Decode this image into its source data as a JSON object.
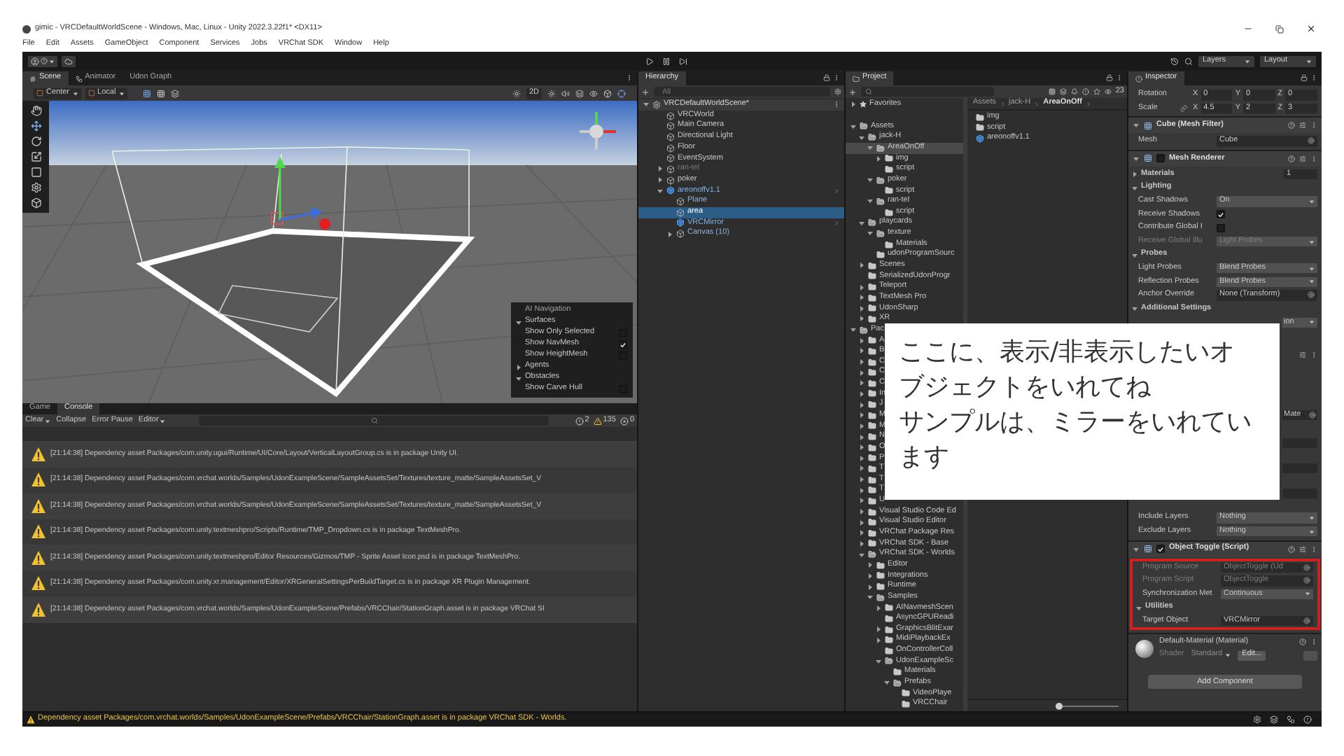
{
  "window": {
    "title": "gimic - VRCDefaultWorldScene - Windows, Mac, Linux - Unity 2022.3.22f1* <DX11>",
    "menu": [
      "File",
      "Edit",
      "Assets",
      "GameObject",
      "Component",
      "Services",
      "Jobs",
      "VRChat SDK",
      "Window",
      "Help"
    ]
  },
  "toolbar": {
    "dropdowns": [
      "Layers",
      "Layout"
    ]
  },
  "scene": {
    "tabs": [
      {
        "label": "Scene",
        "selected": true
      },
      {
        "label": "Animator",
        "selected": false
      },
      {
        "label": "Udon Graph",
        "selected": false
      }
    ],
    "pivot": [
      "Center",
      "Local"
    ],
    "mode_label": "2D",
    "ai_navigation": {
      "title": "AI Navigation",
      "sections": [
        {
          "label": "Surfaces",
          "expanded": true,
          "options": [
            {
              "label": "Show Only Selected",
              "checked": false
            },
            {
              "label": "Show NavMesh",
              "checked": true
            },
            {
              "label": "Show HeightMesh",
              "checked": false
            }
          ]
        },
        {
          "label": "Agents",
          "expanded": false
        },
        {
          "label": "Obstacles",
          "expanded": true,
          "options": [
            {
              "label": "Show Carve Hull",
              "checked": false
            }
          ]
        }
      ]
    }
  },
  "console": {
    "tabs": [
      {
        "label": "Game",
        "selected": false
      },
      {
        "label": "Console",
        "selected": true
      }
    ],
    "buttons": [
      "Clear",
      "Collapse",
      "Error Pause",
      "Editor"
    ],
    "counts": [
      {
        "kind": "info",
        "value": "2"
      },
      {
        "kind": "warning",
        "value": "135"
      },
      {
        "kind": "error",
        "value": "0"
      }
    ],
    "logs": [
      "[21:14:38] Dependency asset Packages/com.unity.ugui/Runtime/UI/Core/Layout/VerticalLayoutGroup.cs is in package Unity UI.",
      "[21:14:38] Dependency asset Packages/com.vrchat.worlds/Samples/UdonExampleScene/SampleAssetsSet/Textures/texture_matte/SampleAssetsSet_V",
      "[21:14:38] Dependency asset Packages/com.vrchat.worlds/Samples/UdonExampleScene/SampleAssetsSet/Textures/texture_matte/SampleAssetsSet_V",
      "[21:14:38] Dependency asset Packages/com.unity.textmeshpro/Scripts/Runtime/TMP_Dropdown.cs is in package TextMeshPro.",
      "[21:14:38] Dependency asset Packages/com.unity.textmeshpro/Editor Resources/Gizmos/TMP - Sprite Asset Icon.psd is in package TextMeshPro.",
      "[21:14:38] Dependency asset Packages/com.unity.xr.management/Editor/XRGeneralSettingsPerBuildTarget.cs is in package XR Plugin Management.",
      "[21:14:38] Dependency asset Packages/com.vrchat.worlds/Samples/UdonExampleScene/Prefabs/VRCChair/StationGraph.asset is in package VRChat SI"
    ],
    "status": "Dependency asset Packages/com.vrchat.worlds/Samples/UdonExampleScene/Prefabs/VRCChair/StationGraph.asset is in package VRChat SDK - Worlds."
  },
  "hierarchy": {
    "title": "Hierarchy",
    "search_placeholder": "All",
    "scene": {
      "label": "VRCDefaultWorldScene*",
      "expanded": true,
      "children": [
        {
          "label": "VRCWorld",
          "kind": "object",
          "selected": false,
          "disabled": false
        },
        {
          "label": "Main Camera",
          "kind": "object",
          "selected": false,
          "disabled": false
        },
        {
          "label": "Directional Light",
          "kind": "object",
          "selected": false,
          "disabled": false
        },
        {
          "label": "Floor",
          "kind": "object",
          "selected": false,
          "disabled": false
        },
        {
          "label": "EventSystem",
          "kind": "object",
          "selected": false,
          "disabled": false
        },
        {
          "label": "ran-tel",
          "kind": "object",
          "selected": false,
          "disabled": true,
          "expanded": false
        },
        {
          "label": "poker",
          "kind": "object",
          "selected": false,
          "disabled": false,
          "expanded": false
        },
        {
          "label": "areonoffv1.1",
          "kind": "prefab",
          "selected": false,
          "disabled": false,
          "expanded": true,
          "children": [
            {
              "label": "Plane",
              "kind": "prefab_part",
              "selected": false,
              "disabled": false
            },
            {
              "label": "area",
              "kind": "prefab_part",
              "selected": true,
              "disabled": false
            },
            {
              "label": "VRCMirror",
              "kind": "prefab",
              "selected": false,
              "disabled": false
            },
            {
              "label": "Canvas (10)",
              "kind": "prefab_part",
              "selected": false,
              "disabled": false,
              "expanded": false
            }
          ]
        }
      ]
    }
  },
  "project": {
    "title": "Project",
    "count": "23",
    "breadcrumb": [
      "Assets",
      "jack-H",
      "AreaOnOff"
    ],
    "tree": [
      {
        "label": "Favorites",
        "kind": "favorites",
        "selected": false,
        "expanded": false
      },
      {
        "label": "Assets",
        "kind": "folder",
        "selected": false,
        "expanded": true,
        "children": [
          {
            "label": "jack-H",
            "selected": false,
            "expanded": true,
            "children": [
              {
                "label": "AreaOnOff",
                "selected": true,
                "expanded": true,
                "children": [
                  {
                    "label": "img",
                    "selected": false,
                    "expanded": false
                  },
                  {
                    "label": "script",
                    "selected": false
                  }
                ]
              },
              {
                "label": "poker",
                "selected": false,
                "expanded": true,
                "children": [
                  {
                    "label": "script",
                    "selected": false
                  }
                ]
              },
              {
                "label": "ran-tel",
                "selected": false,
                "expanded": true,
                "children": [
                  {
                    "label": "script",
                    "selected": false
                  }
                ]
              }
            ]
          },
          {
            "label": "playcards",
            "selected": false,
            "expanded": true,
            "children": [
              {
                "label": "texture",
                "selected": false,
                "expanded": true,
                "children": [
                  {
                    "label": "Materials",
                    "selected": false
                  }
                ]
              },
              {
                "label": "udonProgramSourc",
                "selected": false
              }
            ]
          },
          {
            "label": "Scenes",
            "selected": false,
            "expanded": false
          },
          {
            "label": "SerializedUdonProgr",
            "selected": false
          },
          {
            "label": "Teleport",
            "selected": false,
            "expanded": false
          },
          {
            "label": "TextMesh Pro",
            "selected": false,
            "expanded": false
          },
          {
            "label": "UdonSharp",
            "selected": false,
            "expanded": false
          },
          {
            "label": "XR",
            "selected": false,
            "expanded": false
          }
        ]
      },
      {
        "label": "Pac",
        "kind": "folder",
        "selected": false,
        "expanded": true,
        "children": [
          {
            "label": "A",
            "selected": false,
            "expanded": false
          },
          {
            "label": "B",
            "selected": false,
            "expanded": false
          },
          {
            "label": "C",
            "selected": false,
            "expanded": false
          },
          {
            "label": "C",
            "selected": false,
            "expanded": false
          },
          {
            "label": "C",
            "selected": false,
            "expanded": false
          },
          {
            "label": "In",
            "selected": false,
            "expanded": false
          },
          {
            "label": "J",
            "selected": false,
            "expanded": false
          },
          {
            "label": "M",
            "selected": false,
            "expanded": false
          },
          {
            "label": "M",
            "selected": false,
            "expanded": false
          },
          {
            "label": "N",
            "selected": false,
            "expanded": false
          },
          {
            "label": "O",
            "selected": false,
            "expanded": false
          },
          {
            "label": "P",
            "selected": false,
            "expanded": false
          },
          {
            "label": "T",
            "selected": false,
            "expanded": false
          },
          {
            "label": "T",
            "selected": false,
            "expanded": false
          },
          {
            "label": "T",
            "selected": false,
            "expanded": false
          },
          {
            "label": "U",
            "selected": false,
            "expanded": false
          },
          {
            "label": "Visual Studio Code Ed",
            "selected": false,
            "expanded": false
          },
          {
            "label": "Visual Studio Editor",
            "selected": false,
            "expanded": false
          },
          {
            "label": "VRChat Package Res",
            "selected": false,
            "expanded": false
          },
          {
            "label": "VRChat SDK - Base",
            "selected": false,
            "expanded": false
          },
          {
            "label": "VRChat SDK - Worlds",
            "selected": false,
            "expanded": true,
            "children": [
              {
                "label": "Editor",
                "selected": false,
                "expanded": false
              },
              {
                "label": "Integrations",
                "selected": false,
                "expanded": false
              },
              {
                "label": "Runtime",
                "selected": false,
                "expanded": false
              },
              {
                "label": "Samples",
                "selected": false,
                "expanded": true,
                "children": [
                  {
                    "label": "AINavmeshScen",
                    "selected": false,
                    "expanded": false
                  },
                  {
                    "label": "AsyncGPUReadi",
                    "selected": false
                  },
                  {
                    "label": "GraphicsBlitExar",
                    "selected": false,
                    "expanded": false
                  },
                  {
                    "label": "MidiPlaybackEx",
                    "selected": false,
                    "expanded": false
                  },
                  {
                    "label": "OnControllerColl",
                    "selected": false
                  },
                  {
                    "label": "UdonExampleSc",
                    "selected": false,
                    "expanded": true,
                    "children": [
                      {
                        "label": "Materials",
                        "selected": false
                      },
                      {
                        "label": "Prefabs",
                        "selected": false,
                        "expanded": true,
                        "children": [
                          {
                            "label": "VideoPlaye",
                            "selected": false
                          },
                          {
                            "label": "VRCChair",
                            "selected": false
                          }
                        ]
                      }
                    ]
                  }
                ]
              }
            ]
          }
        ]
      }
    ],
    "files": [
      {
        "label": "img",
        "kind": "folder"
      },
      {
        "label": "script",
        "kind": "folder"
      },
      {
        "label": "areonoffv1.1",
        "kind": "prefab"
      }
    ],
    "zoom_slider": {
      "level": 0.05
    }
  },
  "inspector": {
    "title": "Inspector",
    "rows": [
      {
        "kind": "vector",
        "label": "Rotation",
        "constrained": false,
        "values": [
          {
            "axis": "X",
            "value": "0"
          },
          {
            "axis": "Y",
            "value": "0"
          },
          {
            "axis": "Z",
            "value": "0"
          }
        ]
      },
      {
        "kind": "vector",
        "label": "Scale",
        "constrained": true,
        "values": [
          {
            "axis": "X",
            "value": "4.5"
          },
          {
            "axis": "Y",
            "value": "2"
          },
          {
            "axis": "Z",
            "value": "3"
          }
        ]
      },
      {
        "kind": "header",
        "label": "Cube (Mesh Filter)",
        "expanded": true
      },
      {
        "kind": "field",
        "label": "Mesh",
        "value": "Cube",
        "disabled": false
      },
      {
        "kind": "header",
        "label": "Mesh Renderer",
        "expanded": true,
        "enabled": false
      },
      {
        "kind": "section",
        "label": "Materials",
        "expanded": false,
        "value": "1"
      },
      {
        "kind": "section",
        "label": "Lighting",
        "expanded": true
      },
      {
        "kind": "dropdown",
        "label": "Cast Shadows",
        "value": "On",
        "disabled": false
      },
      {
        "kind": "check",
        "label": "Receive Shadows",
        "checked": true
      },
      {
        "kind": "check",
        "label": "Contribute Global I",
        "checked": false
      },
      {
        "kind": "dropdown",
        "label": "Receive Global Illu",
        "value": "Light Probes",
        "disabled": true
      },
      {
        "kind": "section",
        "label": "Probes",
        "expanded": true
      },
      {
        "kind": "dropdown",
        "label": "Light Probes",
        "value": "Blend Probes",
        "disabled": false
      },
      {
        "kind": "dropdown",
        "label": "Reflection Probes",
        "value": "Blend Probes",
        "disabled": false
      },
      {
        "kind": "field",
        "label": "Anchor Override",
        "value": "None (Transform)",
        "disabled": false
      },
      {
        "kind": "section",
        "label": "Additional Settings",
        "expanded": true
      },
      {
        "kind": "partial_dropdown",
        "value": "ion"
      },
      {
        "kind": "partial_header"
      },
      {
        "kind": "partial_field",
        "value": "Mate"
      },
      {
        "kind": "partial_blank"
      },
      {
        "kind": "partial_blank"
      },
      {
        "kind": "partial_blank"
      },
      {
        "kind": "dropdown",
        "label": "Include Layers",
        "value": "Nothing",
        "disabled": false
      },
      {
        "kind": "dropdown",
        "label": "Exclude Layers",
        "value": "Nothing",
        "disabled": false
      },
      {
        "kind": "header",
        "label": "Object Toggle (Script)",
        "expanded": true,
        "enabled": true
      },
      {
        "kind": "group",
        "highlighted": true,
        "rows": [
          {
            "kind": "field",
            "label": "Program Source",
            "value": "ObjectToggle (Ud",
            "disabled": true
          },
          {
            "kind": "field",
            "label": "Program Script",
            "value": "ObjectToggle",
            "disabled": true
          },
          {
            "kind": "dropdown",
            "label": "Synchronization Met",
            "value": "Continuous",
            "disabled": false
          },
          {
            "kind": "section",
            "label": "Utilities",
            "expanded": true
          },
          {
            "kind": "field",
            "label": "Target Object",
            "value": "VRCMirror",
            "disabled": false
          }
        ]
      },
      {
        "kind": "material",
        "label": "Default-Material (Material)",
        "shader_label": "Shader",
        "shader": "Standard",
        "edit": "Edit..."
      },
      {
        "kind": "button",
        "label": "Add Component"
      }
    ]
  },
  "note": {
    "lines": [
      "ここに、表示/非表示したいオ",
      "ブジェクトをいれてね",
      "サンプルは、ミラーをいれてい",
      "ます"
    ]
  }
}
